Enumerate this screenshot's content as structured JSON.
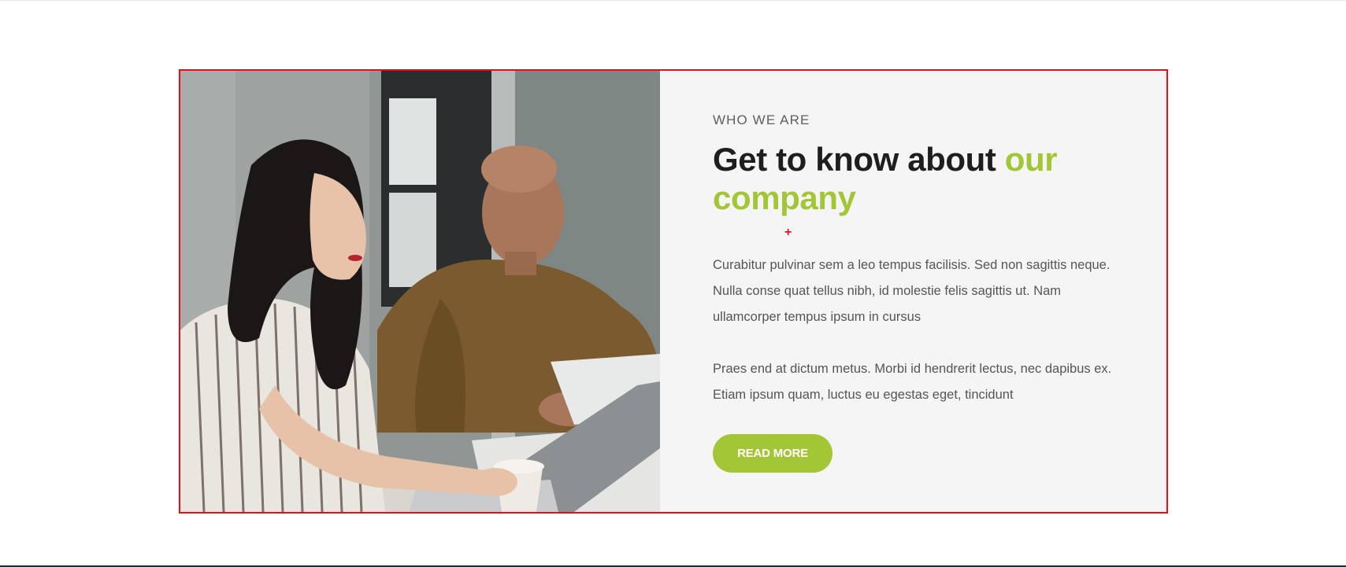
{
  "colors": {
    "accent": "#a2c635",
    "selection_outline": "#e3101c",
    "panel_bg": "#f5f5f5",
    "heading_text": "#1e1e1e",
    "body_text": "#555555"
  },
  "about": {
    "kicker": "WHO WE ARE",
    "heading_part1": "Get to know about ",
    "heading_accent": "our company",
    "paragraph1": "Curabitur pulvinar sem a leo tempus facilisis. Sed non sagittis neque. Nulla conse quat tellus nibh, id molestie felis sagittis ut. Nam ullamcorper tempus ipsum in cursus",
    "paragraph2": "Praes end at dictum metus. Morbi id hendrerit lectus, nec dapibus ex. Etiam ipsum quam, luctus eu egestas eget, tincidunt",
    "button_label": "READ MORE",
    "cursor_glyph": "+"
  },
  "image": {
    "subject": "two-colleagues-working-on-laptop-photo"
  }
}
